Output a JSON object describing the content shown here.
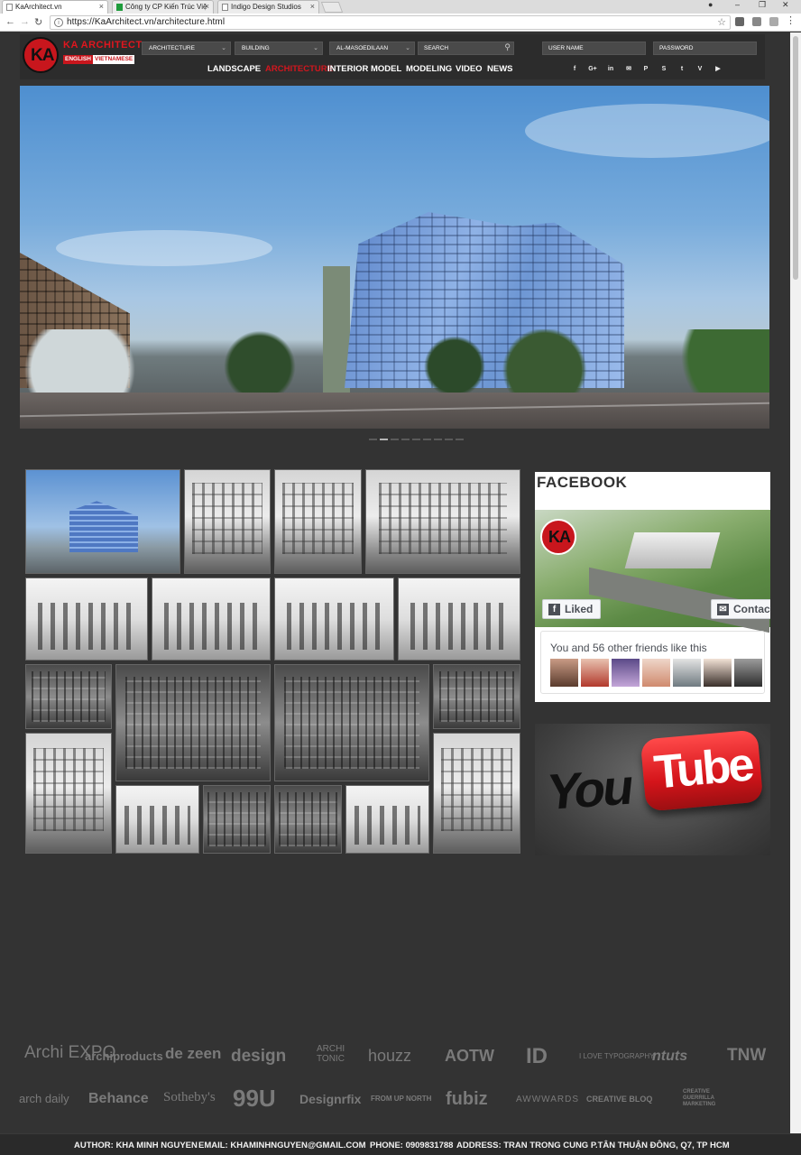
{
  "browser": {
    "tabs": [
      {
        "title": "KaArchitect.vn",
        "active": true
      },
      {
        "title": "Công ty CP Kiến Trúc Việ",
        "active": false
      },
      {
        "title": "Indigo Design Studios",
        "active": false
      }
    ],
    "url": "https://KaArchitect.vn/architecture.html",
    "window_controls": [
      "–",
      "❐",
      "✕"
    ],
    "nav": {
      "back": "←",
      "forward": "→",
      "reload": "↻"
    },
    "info_icon": "ⓘ",
    "bookmark_icon": "☆"
  },
  "header": {
    "logo_text": "KA",
    "brand": "KA ARCHITECT",
    "lang_en": "ENGLISH",
    "lang_vn": "VIETNAMESE",
    "selects": [
      "ARCHITECTURE",
      "BUILDING",
      "AL-MASOEDILAAN"
    ],
    "search_placeholder": "SEARCH",
    "username_placeholder": "USER NAME",
    "password_placeholder": "PASSWORD",
    "nav": [
      "LANDSCAPE",
      "ARCHITECTURE",
      "INTERIOR",
      "MODEL",
      "MODELING",
      "VIDEO",
      "NEWS"
    ],
    "active_nav": "ARCHITECTURE",
    "social": [
      {
        "name": "facebook-icon",
        "glyph": "f"
      },
      {
        "name": "google-plus-icon",
        "glyph": "G+"
      },
      {
        "name": "linkedin-icon",
        "glyph": "in"
      },
      {
        "name": "mail-icon",
        "glyph": "✉"
      },
      {
        "name": "pinterest-icon",
        "glyph": "P"
      },
      {
        "name": "skype-icon",
        "glyph": "S"
      },
      {
        "name": "twitter-icon",
        "glyph": "t"
      },
      {
        "name": "vimeo-icon",
        "glyph": "V"
      },
      {
        "name": "youtube-icon",
        "glyph": "▶"
      }
    ]
  },
  "slider": {
    "count": 9,
    "active_index": 1
  },
  "facebook": {
    "title": "FACEBOOK",
    "avatar_text": "KA",
    "liked_label": "Liked",
    "contact_label": "Contac",
    "friends_text": "You and 56 other friends like this"
  },
  "youtube": {
    "you": "You",
    "tube": "Tube"
  },
  "partners": [
    "Archi EXPO",
    "archiproducts",
    "de zeen",
    "design",
    "ARCHI TONIC",
    "houzz",
    "AOTW",
    "ID",
    "I LOVE TYPOGRAPHY",
    "ntuts",
    "TNW",
    "arch daily",
    "Behance",
    "Sotheby's",
    "99U",
    "Designrfix",
    "FROM UP NORTH",
    "fubiz",
    "AWWWARDS",
    "CREATIVE BLOQ",
    "CREATIVE GUERRILLA MARKETING"
  ],
  "footer": {
    "author": "AUTHOR: KHA MINH NGUYEN",
    "email": "EMAIL: KHAMINHNGUYEN@GMAIL.COM",
    "phone": "PHONE: 0909831788",
    "address": "ADDRESS: TRAN TRONG CUNG P.TÂN THUẬN ĐÔNG, Q7, TP HCM"
  },
  "colors": {
    "accent": "#d2161e",
    "page_bg": "#333333",
    "header_bg": "#2c2c2c"
  }
}
